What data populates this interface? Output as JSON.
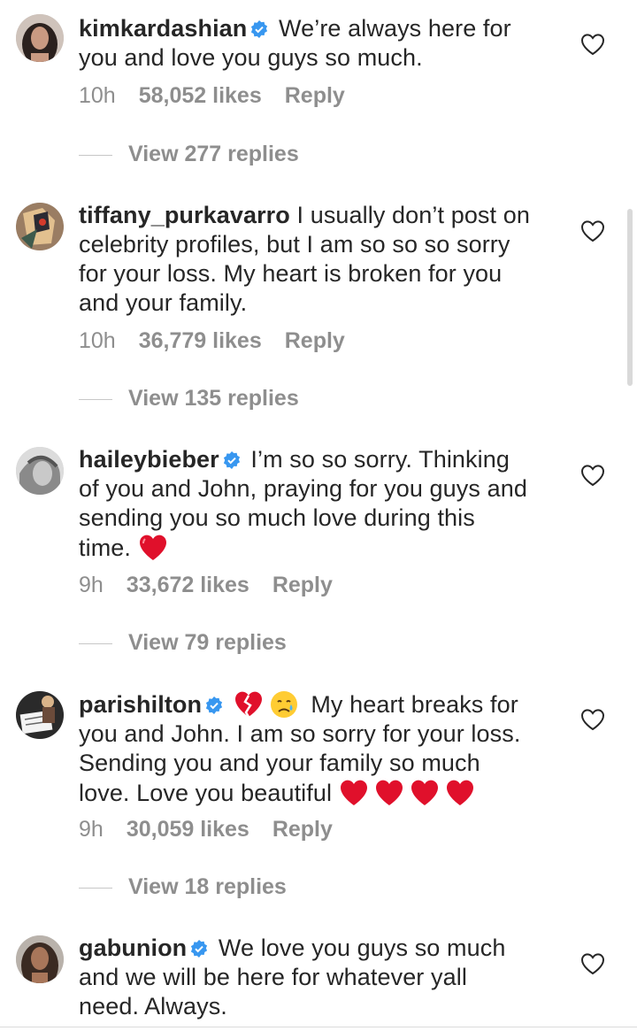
{
  "comments": [
    {
      "username": "kimkardashian",
      "verified": true,
      "lines": [
        "We’re always here for",
        "you and love you guys so much."
      ],
      "time": "10h",
      "likes": "58,052 likes",
      "reply": "Reply",
      "view_replies": "View 277 replies"
    },
    {
      "username": "tiffany_purkavarro",
      "verified": false,
      "lines": [
        "I usually don’t post on",
        "celebrity profiles, but I am so so so sorry",
        "for your loss. My heart is broken for you",
        "and your family."
      ],
      "time": "10h",
      "likes": "36,779 likes",
      "reply": "Reply",
      "view_replies": "View 135 replies"
    },
    {
      "username": "haileybieber",
      "verified": true,
      "lines": [
        "I’m so so sorry. Thinking",
        "of you and John, praying for you guys and",
        "sending you so much love during this",
        "time."
      ],
      "time": "9h",
      "likes": "33,672 likes",
      "reply": "Reply",
      "view_replies": "View 79 replies"
    },
    {
      "username": "parishilton",
      "verified": true,
      "lines": [
        "My heart breaks for",
        "you and John. I am so sorry for your loss.",
        "Sending you and your family so much",
        "love. Love you beautiful"
      ],
      "time": "9h",
      "likes": "30,059 likes",
      "reply": "Reply",
      "view_replies": "View 18 replies"
    },
    {
      "username": "gabunion",
      "verified": true,
      "lines": [
        "We love you guys so much",
        "and we will be here for whatever yall",
        "need. Always."
      ]
    }
  ],
  "icons": {
    "like": "heart-outline-icon",
    "verified": "verified-badge-icon",
    "red_heart": "red-heart-emoji",
    "broken_heart": "broken-heart-emoji",
    "crying_face": "crying-face-emoji"
  },
  "colors": {
    "text": "#262626",
    "muted": "#8e8e8e",
    "verified": "#3897f0",
    "heart": "#e0102b"
  }
}
